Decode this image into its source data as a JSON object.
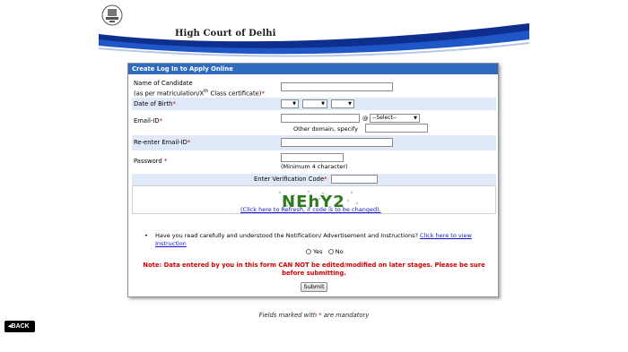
{
  "header": {
    "court_title": "High Court of Delhi"
  },
  "form": {
    "panel_title": "Create Log In to Apply Online",
    "candidate_name": {
      "label_line1": "Name of Candidate",
      "label_line2_prefix": "(as per matriculation/X",
      "label_sup": "th",
      "label_line2_suffix": " Class certificate)",
      "value": ""
    },
    "dob": {
      "label": "Date of Birth",
      "day_value": "",
      "month_value": "",
      "year_value": ""
    },
    "email": {
      "label": "Email-ID",
      "at_symbol": "@",
      "domain_select": "--Select--",
      "other_domain_label": "Other domain, specify",
      "value": ""
    },
    "reenter_email": {
      "label": "Re-enter Email-ID",
      "value": ""
    },
    "password": {
      "label": "Password",
      "hint": "(Minimum 4 character)",
      "value": ""
    },
    "verification": {
      "label": "Enter Verification Code",
      "captcha_text": "NEhY2",
      "refresh_link": "(Click here to Refresh, if code is to be changed)."
    },
    "instructions": {
      "bullet": "•",
      "question": "Have you read carefully and understood the Notification/ Advertisement and Instructions?",
      "link": "Click here to view Instruction",
      "yes_label": "Yes",
      "no_label": "No"
    },
    "note": "Note: Data entered by you in this form CAN NOT be edited/modified on later stages. Please be sure before submitting.",
    "submit_label": "Submit",
    "required_mark": "*"
  },
  "footer": {
    "mandatory_prefix": "Fields marked with",
    "mandatory_mark": "*",
    "mandatory_suffix": "are mandatory",
    "back_label": "◂BACK"
  },
  "colors": {
    "panel_header": "#2f6cc0",
    "row_highlight": "#dfe9f8",
    "required": "#d40000",
    "link": "#1414c8"
  }
}
